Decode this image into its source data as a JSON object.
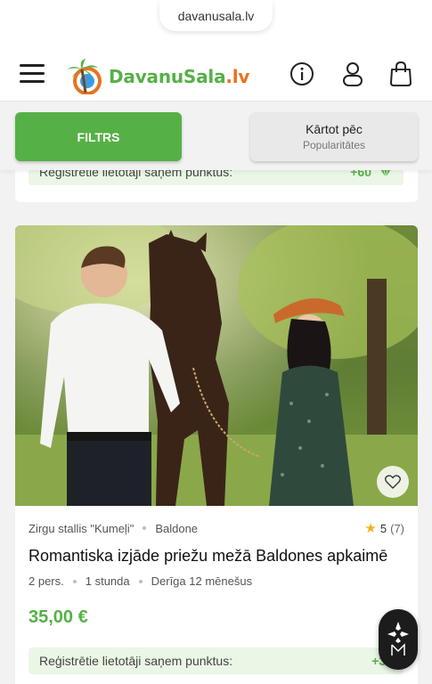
{
  "browser": {
    "url": "davanusala.lv"
  },
  "header": {
    "logo": {
      "part1": "Davanu",
      "part2": "Sala",
      "part3": ".lv"
    },
    "icons": [
      "menu-icon",
      "info-icon",
      "user-icon",
      "shopping-bag-icon"
    ]
  },
  "filters": {
    "filter_label": "FILTRS",
    "sort_label": "Kārtot pēc",
    "sort_value": "Popularitātes"
  },
  "previous_card": {
    "points_text": "Reģistrētie lietotāji saņem punktus:",
    "points_value": "+60"
  },
  "product": {
    "provider": "Zirgu stallis \"Kumeļi\"",
    "location": "Baldone",
    "rating": "5",
    "rating_count": "(7)",
    "title": "Romantiska izjāde priežu mežā Baldones apkaimē",
    "persons": "2 pers.",
    "duration": "1 stunda",
    "validity": "Derīga 12 mēnešus",
    "price": "35,00 €",
    "points_text": "Reģistrētie lietotāji saņem punktus:",
    "points_value": "+35",
    "image": "photo of a couple with a horse in a forest"
  },
  "colors": {
    "brand_green": "#55b146",
    "brand_orange": "#e8731e",
    "points_bg": "#eaf6e6",
    "star": "#f2b21b"
  }
}
